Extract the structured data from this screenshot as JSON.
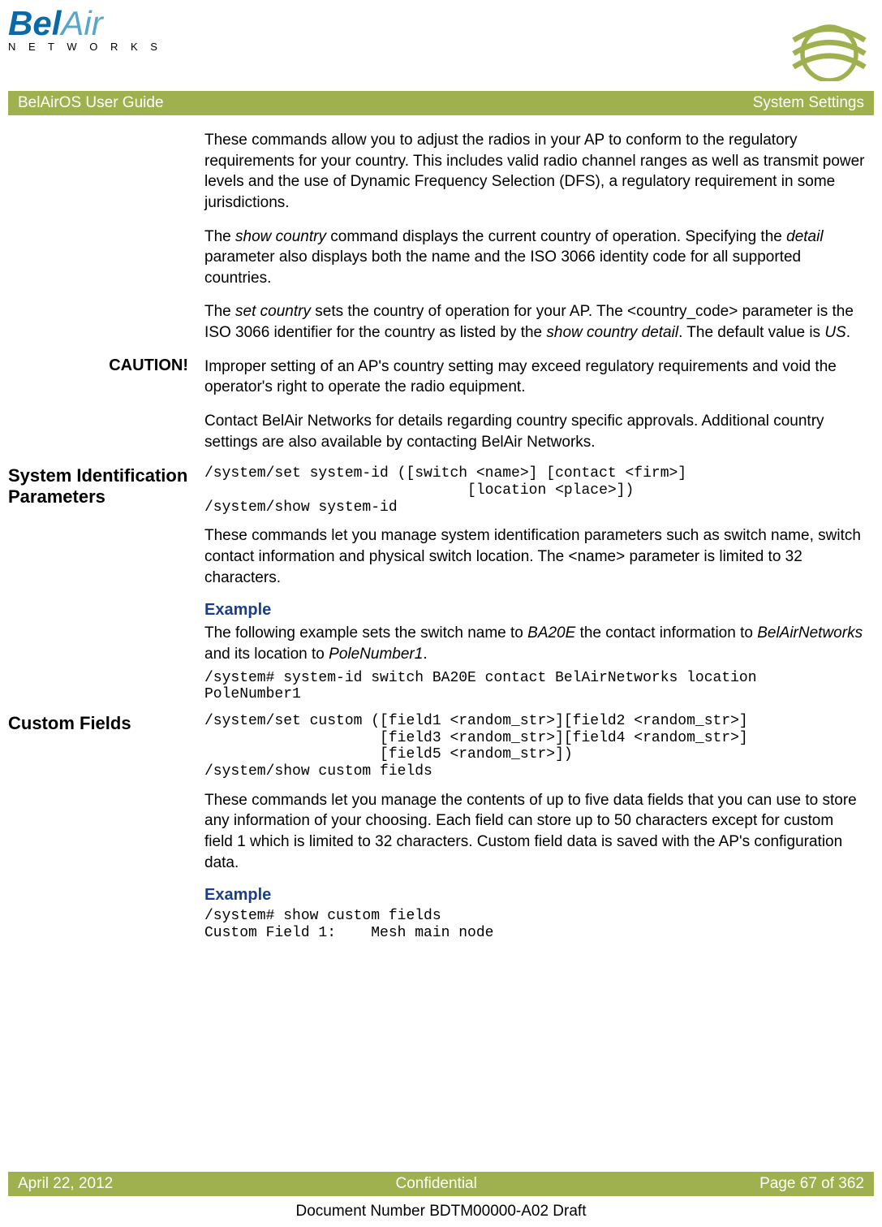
{
  "header": {
    "logo_main": "BelAir",
    "logo_sub": "N E T W O R K S",
    "bar_left": "BelAirOS User Guide",
    "bar_right": "System Settings"
  },
  "intro": {
    "p1": "These commands allow you to adjust the radios in your AP to conform to the regulatory requirements for your country. This includes valid radio channel ranges as well as transmit power levels and the use of Dynamic Frequency Selection (DFS), a regulatory requirement in some jurisdictions.",
    "p2_a": "The ",
    "p2_b": "show country",
    "p2_c": " command displays the current country of operation. Specifying the ",
    "p2_d": "detail",
    "p2_e": " parameter also displays both the name and the ISO 3066 identity code for all supported countries.",
    "p3_a": "The ",
    "p3_b": "set country",
    "p3_c": " sets the country of operation for your AP. The <country_code> parameter is the ISO 3066 identifier for the country as listed by the ",
    "p3_d": "show country detail",
    "p3_e": ". The default value is ",
    "p3_f": "US",
    "p3_g": "."
  },
  "caution": {
    "label": "CAUTION!",
    "p1": "Improper setting of an AP's country setting may exceed regulatory requirements and void the operator's right to operate the radio equipment.",
    "p2": "Contact BelAir Networks for details regarding country specific approvals. Additional country settings are also available by contacting BelAir Networks."
  },
  "sysid": {
    "label": "System Identification Parameters",
    "cmd": "/system/set system-id ([switch <name>] [contact <firm>]\n                              [location <place>])\n/system/show system-id",
    "p1": "These commands let you manage system identification parameters such as switch name, switch contact information and physical switch location. The <name> parameter is limited to 32 characters.",
    "example_h": "Example",
    "ex_a": "The following example sets the switch name to ",
    "ex_b": "BA20E",
    "ex_c": " the contact information to ",
    "ex_d": "BelAirNetworks",
    "ex_e": " and its location to ",
    "ex_f": "PoleNumber1",
    "ex_g": ".",
    "ex_cmd": "/system# system-id switch BA20E contact BelAirNetworks location\nPoleNumber1"
  },
  "custom": {
    "label": "Custom Fields",
    "cmd": "/system/set custom ([field1 <random_str>][field2 <random_str>]\n                    [field3 <random_str>][field4 <random_str>]\n                    [field5 <random_str>])\n/system/show custom fields",
    "p1": "These commands let you manage the contents of up to five data fields that you can use to store any information of your choosing. Each field can store up to 50 characters except for custom field 1 which is limited to 32 characters. Custom field data is saved with the AP's configuration data.",
    "example_h": "Example",
    "ex_cmd": "/system# show custom fields\nCustom Field 1:    Mesh main node"
  },
  "footer": {
    "left": "April 22, 2012",
    "center": "Confidential",
    "right": "Page 67 of 362",
    "docnum": "Document Number BDTM00000-A02 Draft"
  }
}
